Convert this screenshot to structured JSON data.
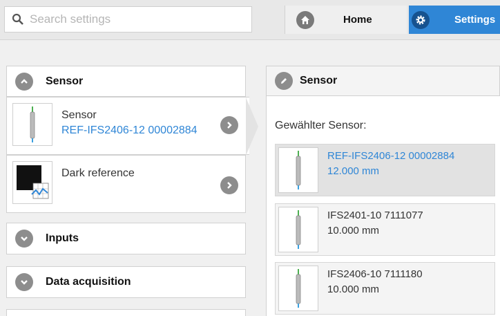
{
  "search": {
    "placeholder": "Search settings",
    "value": ""
  },
  "nav": {
    "home_label": "Home",
    "settings_label": "Settings"
  },
  "left": {
    "sensor_group_title": "Sensor",
    "items": [
      {
        "title": "Sensor",
        "value": "REF-IFS2406-12 00002884"
      },
      {
        "title": "Dark reference",
        "value": ""
      }
    ],
    "inputs_title": "Inputs",
    "data_acquisition_title": "Data acquisition"
  },
  "right": {
    "title": "Sensor",
    "subtitle": "Gewählter Sensor:",
    "sensors": [
      {
        "name": "REF-IFS2406-12 00002884",
        "range": "12.000 mm",
        "selected": true
      },
      {
        "name": "IFS2401-10 7111077",
        "range": "10.000 mm",
        "selected": false
      },
      {
        "name": "IFS2406-10 7111180",
        "range": "10.000 mm",
        "selected": false
      }
    ]
  },
  "colors": {
    "accent": "#2f86d6",
    "icon_gray": "#8d8d8d"
  },
  "icons": [
    "search-icon",
    "home-icon",
    "gear-icon",
    "chevron-up-icon",
    "chevron-right-icon",
    "chevron-down-icon",
    "pencil-icon",
    "sensor-probe-icon",
    "dark-reference-icon"
  ]
}
